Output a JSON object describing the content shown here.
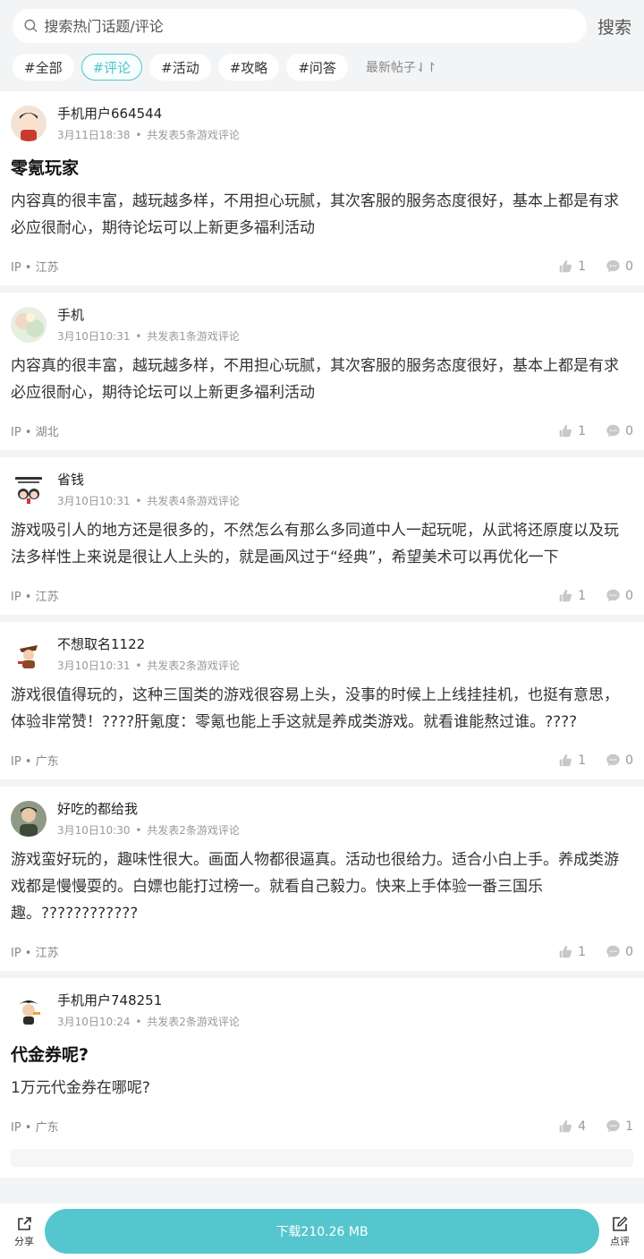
{
  "search": {
    "placeholder": "搜索热门话题/评论",
    "button": "搜索"
  },
  "tabs": [
    "#全部",
    "#评论",
    "#活动",
    "#攻略",
    "#问答"
  ],
  "active_tab": 1,
  "sort_label": "最新帖子⇃↾",
  "posts": [
    {
      "user": "手机用户664544",
      "time": "3月11日18:38",
      "meta": "共发表5条游戏评论",
      "title": "零氪玩家",
      "body": "内容真的很丰富，越玩越多样，不用担心玩腻，其次客服的服务态度很好，基本上都是有求必应很耐心，期待论坛可以上新更多福利活动",
      "ip": "IP • 江苏",
      "likes": "1",
      "comments": "0"
    },
    {
      "user": "手机",
      "time": "3月10日10:31",
      "meta": "共发表1条游戏评论",
      "title": "",
      "body": "内容真的很丰富，越玩越多样，不用担心玩腻，其次客服的服务态度很好，基本上都是有求必应很耐心，期待论坛可以上新更多福利活动",
      "ip": "IP • 湖北",
      "likes": "1",
      "comments": "0"
    },
    {
      "user": "省钱",
      "time": "3月10日10:31",
      "meta": "共发表4条游戏评论",
      "title": "",
      "body": "游戏吸引人的地方还是很多的，不然怎么有那么多同道中人一起玩呢，从武将还原度以及玩法多样性上来说是很让人上头的，就是画风过于“经典”，希望美术可以再优化一下",
      "ip": "IP • 江苏",
      "likes": "1",
      "comments": "0"
    },
    {
      "user": "不想取名1122",
      "time": "3月10日10:31",
      "meta": "共发表2条游戏评论",
      "title": "",
      "body": "游戏很值得玩的，这种三国类的游戏很容易上头，没事的时候上上线挂挂机，也挺有意思，体验非常赞！????肝氪度：零氪也能上手这就是养成类游戏。就看谁能熬过谁。????",
      "ip": "IP • 广东",
      "likes": "1",
      "comments": "0"
    },
    {
      "user": "好吃的都给我",
      "time": "3月10日10:30",
      "meta": "共发表2条游戏评论",
      "title": "",
      "body": "游戏蛮好玩的，趣味性很大。画面人物都很逼真。活动也很给力。适合小白上手。养成类游戏都是慢慢耍的。白嫖也能打过榜一。就看自己毅力。快来上手体验一番三国乐趣。????????????",
      "ip": "IP • 江苏",
      "likes": "1",
      "comments": "0"
    },
    {
      "user": "手机用户748251",
      "time": "3月10日10:24",
      "meta": "共发表2条游戏评论",
      "title": "代金券呢?",
      "body": "1万元代金券在哪呢?",
      "ip": "IP • 广东",
      "likes": "4",
      "comments": "1"
    }
  ],
  "bottom": {
    "share": "分享",
    "download": "下载210.26 MB",
    "review": "点评"
  },
  "colors": {
    "accent": "#4fc3cc",
    "download_bg": "#55c6cd"
  }
}
